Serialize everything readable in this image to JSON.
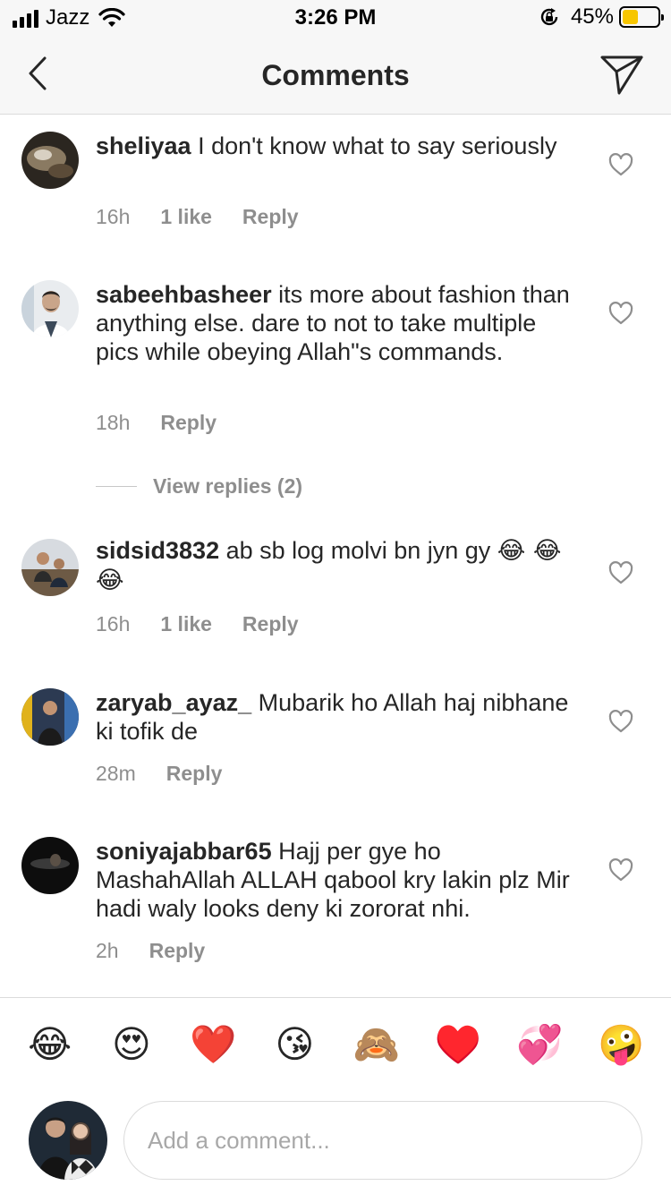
{
  "status_bar": {
    "carrier": "Jazz",
    "time": "3:26 PM",
    "battery_percent": "45%",
    "battery_level": 0.45,
    "icons": [
      "signal-icon",
      "wifi-icon",
      "rotation-lock-icon",
      "battery-icon"
    ]
  },
  "nav": {
    "title": "Comments",
    "back_icon": "chevron-left-icon",
    "send_icon": "paper-plane-icon"
  },
  "comments": [
    {
      "username": "sheliyaa",
      "text": "I don't know what to say seriously",
      "time": "16h",
      "likes": "1 like",
      "reply": "Reply"
    },
    {
      "username": "sabeehbasheer",
      "text": "its more about fashion than anything else. dare to not to take multiple pics while obeying Allah\"s commands.",
      "time": "18h",
      "likes": "",
      "reply": "Reply",
      "view_replies": "View replies (2)"
    },
    {
      "username": "sidsid3832",
      "text": "ab sb log molvi bn jyn gy",
      "emoji": "😂 😂😂",
      "time": "16h",
      "likes": "1 like",
      "reply": "Reply"
    },
    {
      "username": "zaryab_ayaz_",
      "text": "Mubarik ho Allah haj nibhane ki tofik de",
      "time": "28m",
      "likes": "",
      "reply": "Reply"
    },
    {
      "username": "soniyajabbar65",
      "text": "Hajj per gye ho MashahAllah ALLAH qabool kry lakin plz Mir hadi waly looks deny ki zororat nhi.",
      "time": "2h",
      "likes": "",
      "reply": "Reply"
    }
  ],
  "emoji_bar": [
    "😂",
    "😍",
    "❤️",
    "😘",
    "🙈",
    "♥️",
    "💞",
    "🤪"
  ],
  "composer": {
    "placeholder": "Add a comment..."
  },
  "colors": {
    "text": "#262626",
    "meta": "#8e8e8e",
    "divider": "#dbdbdb",
    "bar_bg": "#f7f7f7",
    "battery_fill": "#f7c600"
  }
}
